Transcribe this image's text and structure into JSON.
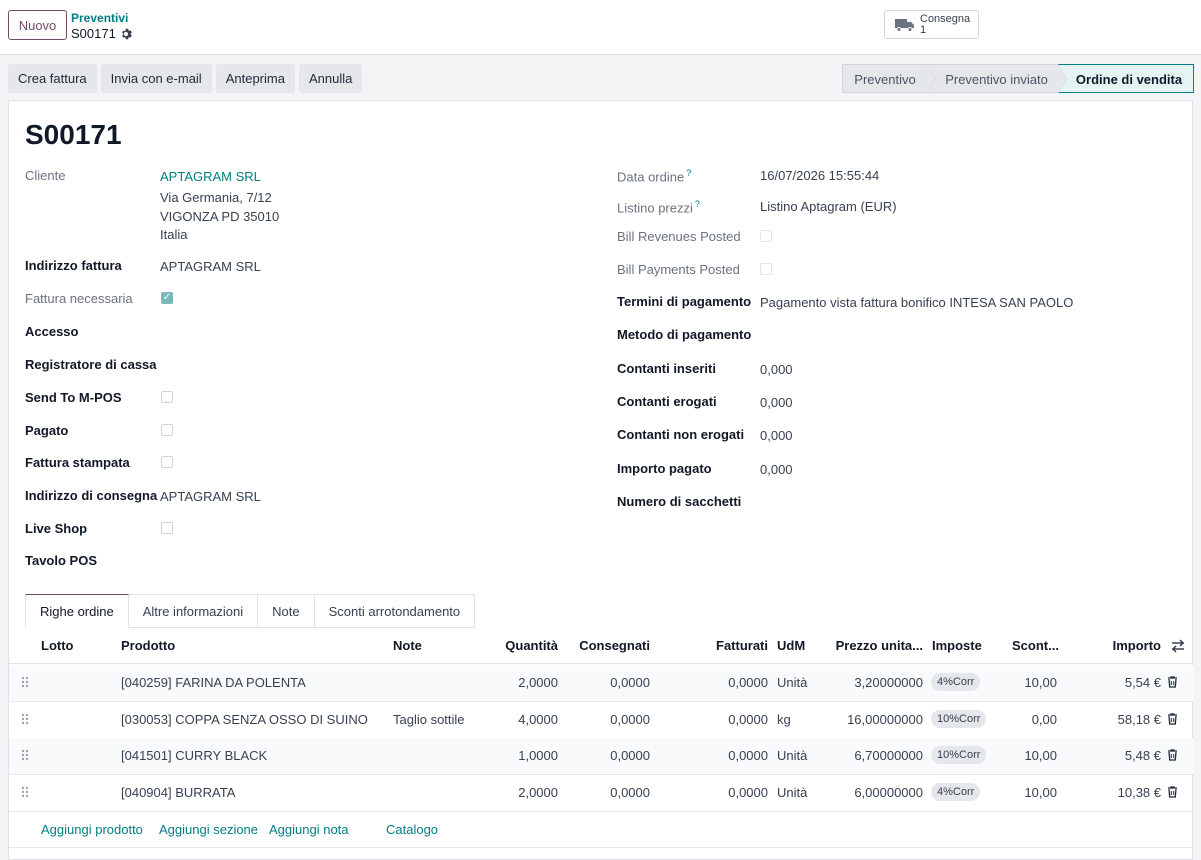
{
  "control": {
    "new_label": "Nuovo",
    "breadcrumb_parent": "Preventivi",
    "breadcrumb_current": "S00171",
    "smart_button": {
      "label": "Consegna",
      "count": "1"
    }
  },
  "actions": [
    "Crea fattura",
    "Invia con e-mail",
    "Anteprima",
    "Annulla"
  ],
  "status_stages": [
    "Preventivo",
    "Preventivo inviato",
    "Ordine di vendita"
  ],
  "status_active": "Ordine di vendita",
  "form": {
    "title": "S00171",
    "left": {
      "cliente_label": "Cliente",
      "cliente_name": "APTAGRAM SRL",
      "cliente_addr1": "Via Germania, 7/12",
      "cliente_addr2": "VIGONZA PD 35010",
      "cliente_addr3": "Italia",
      "indirizzo_fattura_label": "Indirizzo fattura",
      "indirizzo_fattura_value": "APTAGRAM SRL",
      "fattura_necessaria_label": "Fattura necessaria",
      "fattura_necessaria_checked": true,
      "accesso_label": "Accesso",
      "registratore_label": "Registratore di cassa",
      "send_mpos_label": "Send To M-POS",
      "send_mpos_checked": false,
      "pagato_label": "Pagato",
      "pagato_checked": false,
      "fattura_stampata_label": "Fattura stampata",
      "fattura_stampata_checked": false,
      "indirizzo_consegna_label": "Indirizzo di consegna",
      "indirizzo_consegna_value": "APTAGRAM SRL",
      "live_shop_label": "Live Shop",
      "live_shop_checked": false,
      "tavolo_pos_label": "Tavolo POS"
    },
    "right": {
      "data_ordine_label": "Data ordine",
      "data_ordine_help": "?",
      "data_ordine_value": "16/07/2026 15:55:44",
      "listino_label": "Listino prezzi",
      "listino_help": "?",
      "listino_value": "Listino Aptagram (EUR)",
      "bill_revenues_label": "Bill Revenues Posted",
      "bill_revenues_checked": false,
      "bill_payments_label": "Bill Payments Posted",
      "bill_payments_checked": false,
      "termini_label": "Termini di pagamento",
      "termini_value": "Pagamento vista fattura bonifico INTESA SAN PAOLO",
      "metodo_label": "Metodo di pagamento",
      "contanti_inseriti_label": "Contanti inseriti",
      "contanti_inseriti_value": "0,000",
      "contanti_erogati_label": "Contanti erogati",
      "contanti_erogati_value": "0,000",
      "contanti_non_erogati_label": "Contanti non erogati",
      "contanti_non_erogati_value": "0,000",
      "importo_pagato_label": "Importo pagato",
      "importo_pagato_value": "0,000",
      "numero_sacchetti_label": "Numero di sacchetti"
    }
  },
  "tabs": [
    "Righe ordine",
    "Altre informazioni",
    "Note",
    "Sconti arrotondamento"
  ],
  "table": {
    "headers": {
      "lotto": "Lotto",
      "prodotto": "Prodotto",
      "note": "Note",
      "quantita": "Quantità",
      "consegnati": "Consegnati",
      "fatturati": "Fatturati",
      "udm": "UdM",
      "prezzo": "Prezzo unita...",
      "imposte": "Imposte",
      "sconto": "Scont...",
      "importo": "Importo"
    },
    "rows": [
      {
        "prodotto": "[040259] FARINA DA POLENTA",
        "note": "",
        "quantita": "2,0000",
        "consegnati": "0,0000",
        "fatturati": "0,0000",
        "udm": "Unità",
        "prezzo": "3,20000000",
        "imposte": "4%Corr",
        "sconto": "10,00",
        "importo": "5,54 €"
      },
      {
        "prodotto": "[030053] COPPA SENZA OSSO DI SUINO",
        "note": "Taglio sottile",
        "quantita": "4,0000",
        "consegnati": "0,0000",
        "fatturati": "0,0000",
        "udm": "kg",
        "prezzo": "16,00000000",
        "imposte": "10%Corr",
        "sconto": "0,00",
        "importo": "58,18 €"
      },
      {
        "prodotto": "[041501] CURRY BLACK",
        "note": "",
        "quantita": "1,0000",
        "consegnati": "0,0000",
        "fatturati": "0,0000",
        "udm": "Unità",
        "prezzo": "6,70000000",
        "imposte": "10%Corr",
        "sconto": "10,00",
        "importo": "5,48 €"
      },
      {
        "prodotto": "[040904] BURRATA",
        "note": "",
        "quantita": "2,0000",
        "consegnati": "0,0000",
        "fatturati": "0,0000",
        "udm": "Unità",
        "prezzo": "6,00000000",
        "imposte": "4%Corr",
        "sconto": "10,00",
        "importo": "10,38 €"
      }
    ],
    "add_links": {
      "prodotto": "Aggiungi prodotto",
      "sezione": "Aggiungi sezione",
      "nota": "Aggiungi nota",
      "catalogo": "Catalogo"
    }
  },
  "colors": {
    "primary": "#714b67",
    "link": "#017e84"
  }
}
